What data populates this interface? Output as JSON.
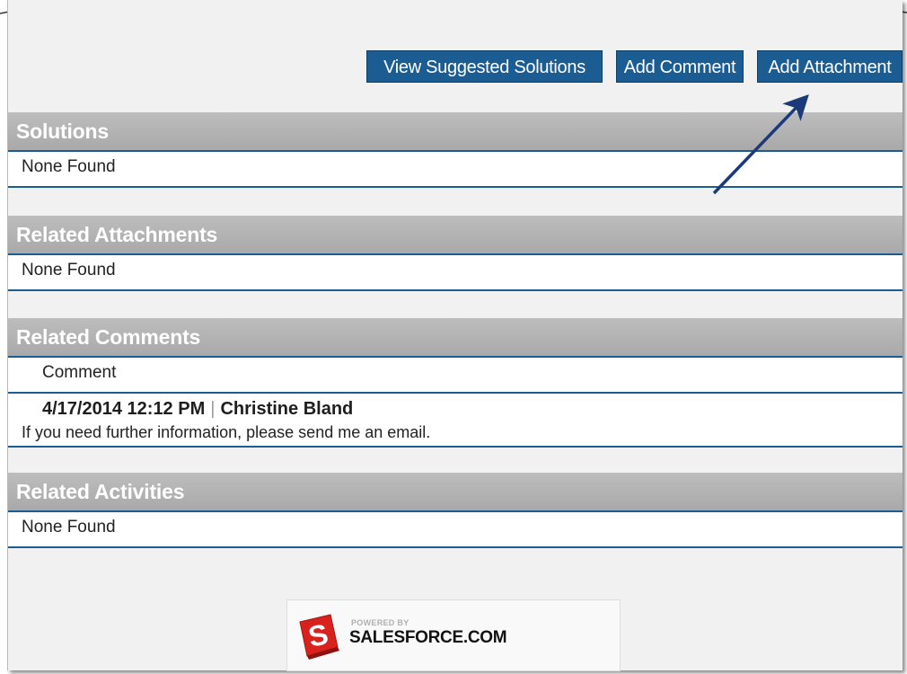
{
  "toolbar": {
    "view_solutions_label": "View Suggested Solutions",
    "add_comment_label": "Add Comment",
    "add_attachment_label": "Add Attachment"
  },
  "sections": {
    "solutions": {
      "title": "Solutions",
      "empty_text": "None Found"
    },
    "attachments": {
      "title": "Related Attachments",
      "empty_text": "None Found"
    },
    "comments": {
      "title": "Related Comments",
      "column_header": "Comment",
      "items": [
        {
          "timestamp": "4/17/2014 12:12 PM",
          "separator": "|",
          "author": "Christine Bland",
          "text": "If you need further information, please send me an email."
        }
      ]
    },
    "activities": {
      "title": "Related Activities",
      "empty_text": "None Found"
    }
  },
  "footer": {
    "powered_by": "POWERED BY",
    "brand": "SALESFORCE.COM",
    "logo_letter": "S"
  },
  "colors": {
    "button_bg": "#1b5c93",
    "header_bg": "#aeaeae",
    "accent_line": "#1b5c93",
    "arrow": "#1b3a7a",
    "logo_red": "#d9221d"
  },
  "icons": [
    "salesforce-logo-icon",
    "annotation-arrow-icon"
  ]
}
